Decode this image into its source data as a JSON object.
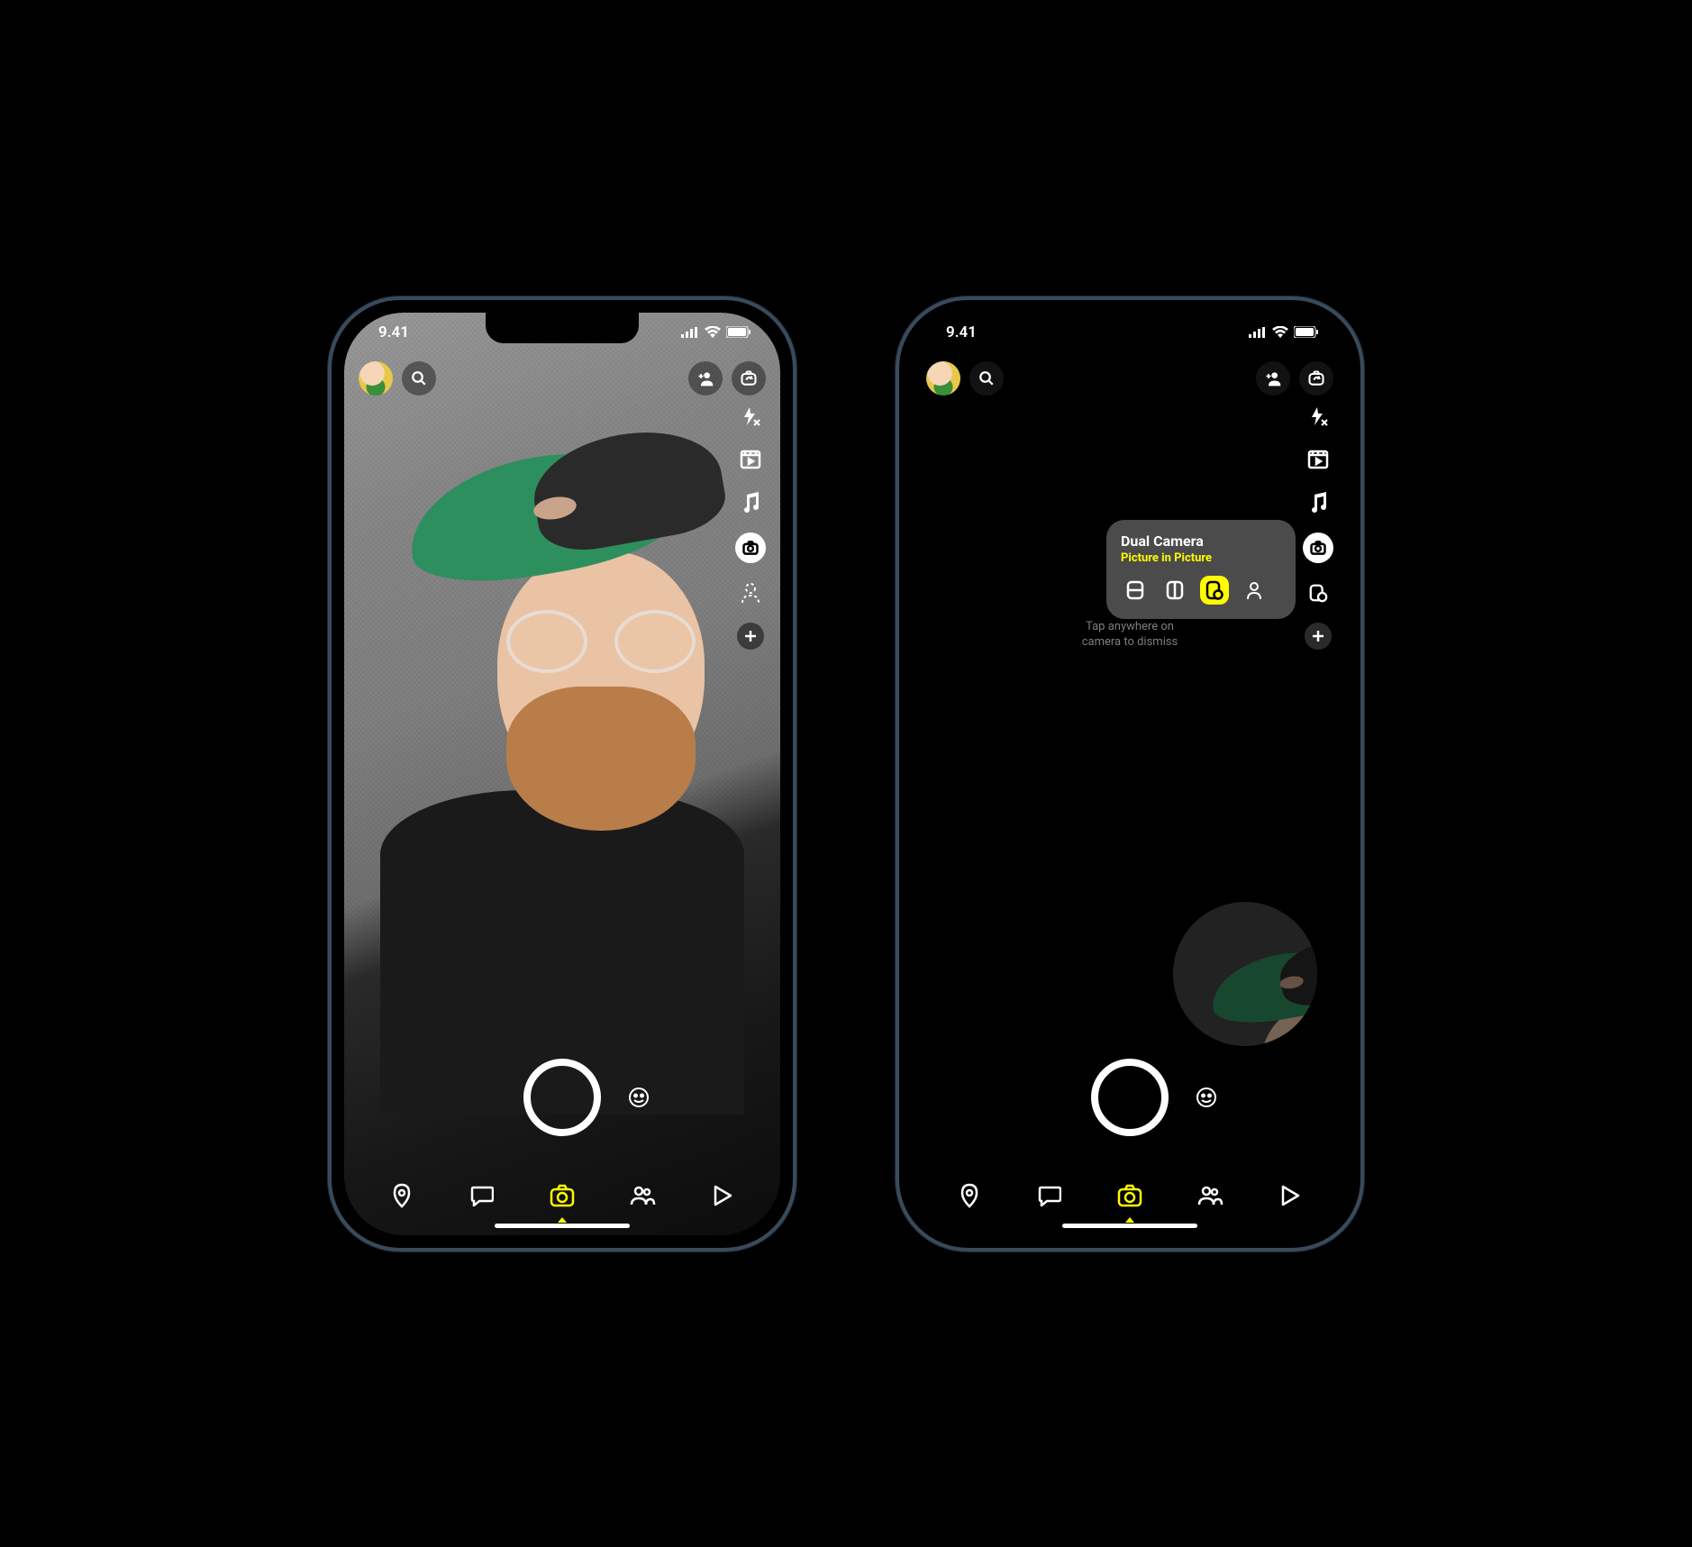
{
  "status": {
    "time": "9.41"
  },
  "tooltip": {
    "title": "Dual Camera",
    "subtitle": "Picture in Picture",
    "hint_line1": "Tap anywhere on",
    "hint_line2": "camera to dismiss"
  },
  "icons": {
    "search": "search-icon",
    "add_friend": "add-friend-icon",
    "flip": "camera-flip-icon",
    "flash": "flash-off-icon",
    "video": "video-icon",
    "music": "music-icon",
    "dual": "dual-camera-icon",
    "dual_small": "dual-camera-small-icon",
    "person_dashed": "person-outline-icon",
    "plus": "plus-icon",
    "shutter": "shutter-button",
    "emoji": "emoji-icon",
    "nav_map": "map-pin-icon",
    "nav_chat": "chat-icon",
    "nav_camera": "camera-icon",
    "nav_stories": "people-icon",
    "nav_play": "play-icon",
    "opt_horiz": "split-horizontal-icon",
    "opt_vert": "split-vertical-icon",
    "opt_pip": "picture-in-picture-icon",
    "opt_cutout": "cutout-icon"
  },
  "colors": {
    "yellow": "#fffc00"
  }
}
